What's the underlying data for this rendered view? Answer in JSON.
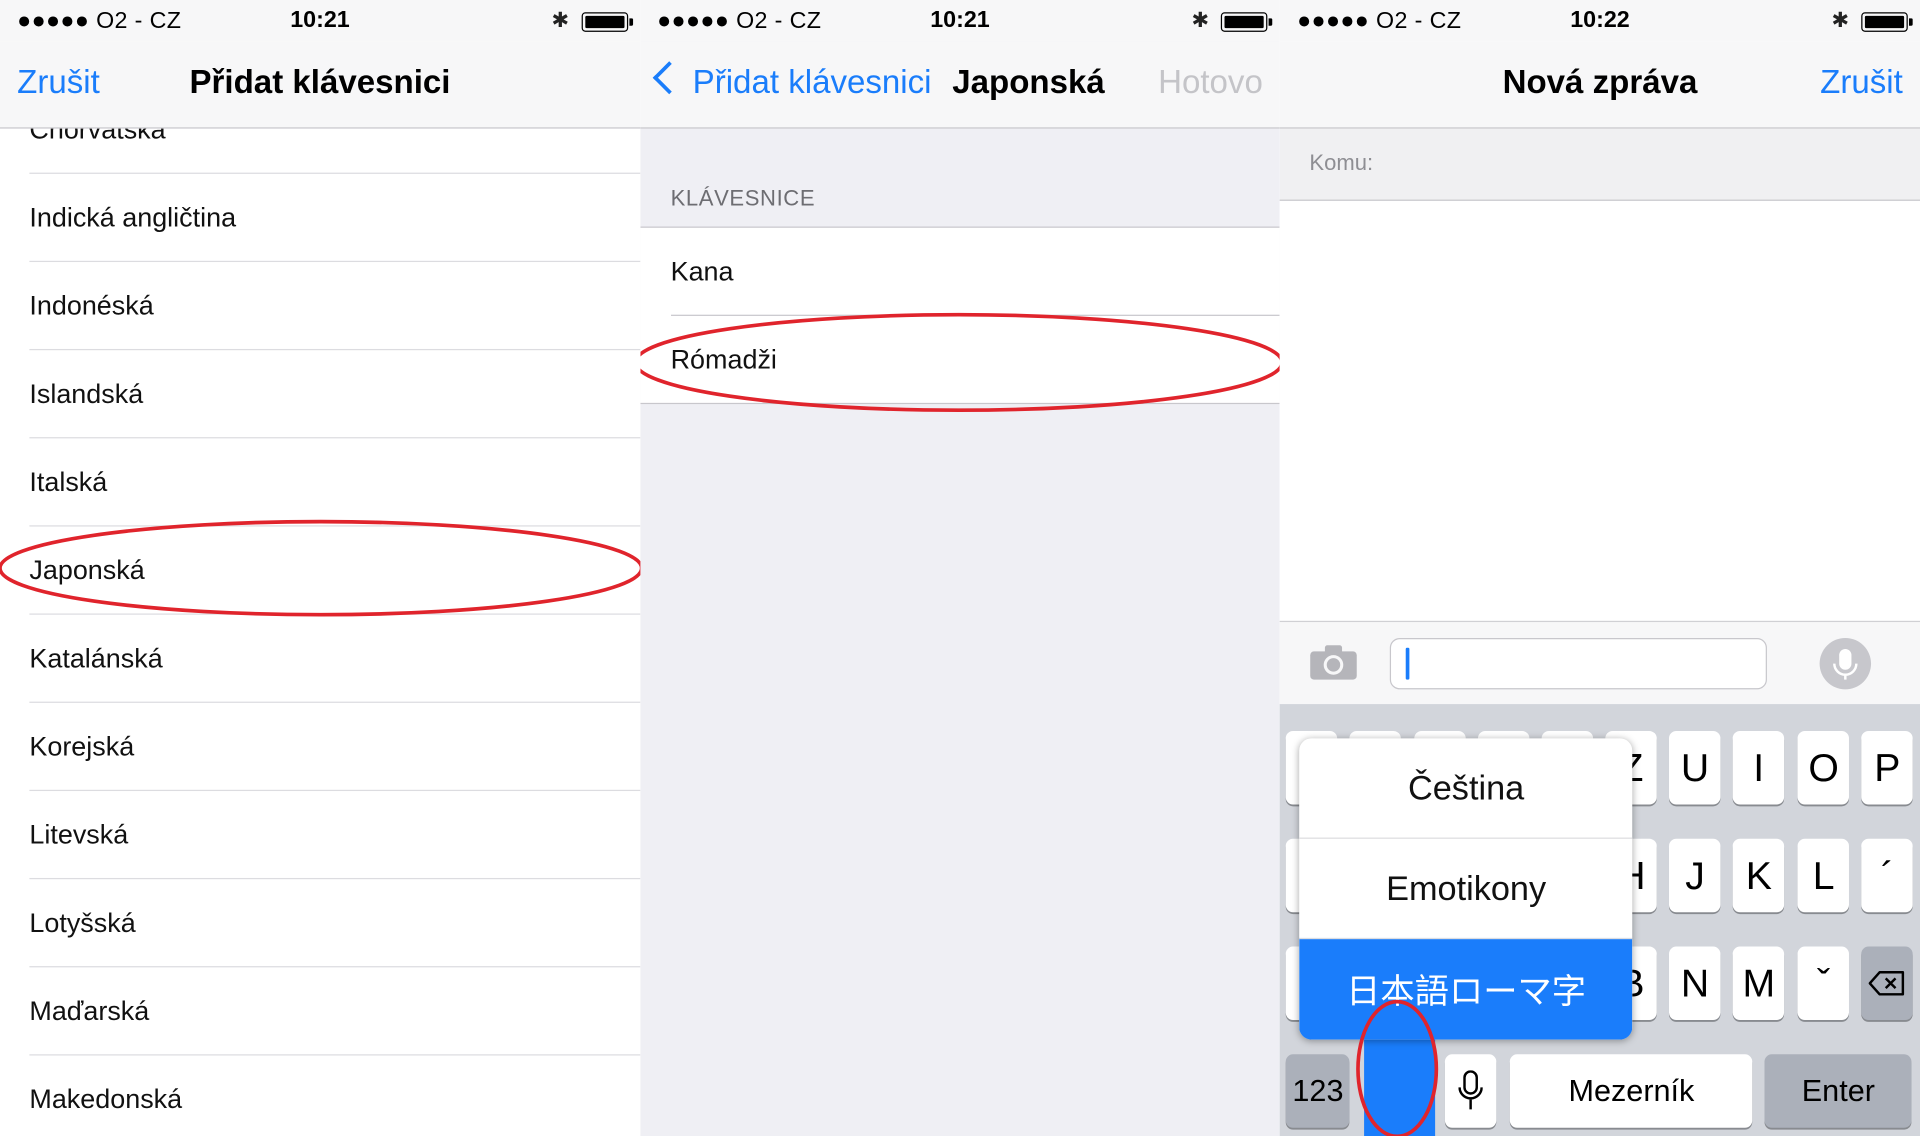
{
  "status": [
    {
      "carrier": "●●●●● O2 - CZ",
      "time": "10:21"
    },
    {
      "carrier": "●●●●● O2 - CZ",
      "time": "10:21"
    },
    {
      "carrier": "●●●●● O2 - CZ",
      "time": "10:22"
    }
  ],
  "panel1": {
    "nav": {
      "cancel": "Zrušit",
      "title": "Přidat klávesnici"
    },
    "items": [
      "Chorvatská",
      "Indická angličtina",
      "Indonéská",
      "Islandská",
      "Italská",
      "Japonská",
      "Katalánská",
      "Korejská",
      "Litevská",
      "Lotyšská",
      "Maďarská",
      "Makedonská"
    ],
    "highlighted": "Japonská"
  },
  "panel2": {
    "nav": {
      "back": "Přidat klávesnici",
      "title": "Japonská",
      "done": "Hotovo"
    },
    "section": "KLÁVESNICE",
    "items": [
      "Kana",
      "Rómadži"
    ],
    "highlighted": "Rómadži"
  },
  "panel3": {
    "nav": {
      "title": "Nová zpráva",
      "cancel": "Zrušit"
    },
    "to_label": "Komu:",
    "keys": {
      "row1_visible": [
        "Z",
        "U",
        "I",
        "O",
        "P"
      ],
      "row2_visible": [
        "H",
        "J",
        "K",
        "L",
        "´"
      ],
      "row3_visible": [
        "B",
        "N",
        "M",
        "ˇ"
      ],
      "numbers": "123",
      "space": "Mezerník",
      "enter": "Enter"
    },
    "popup": {
      "options": [
        "Čeština",
        "Emotikony",
        "日本語ローマ字"
      ],
      "selected": "日本語ローマ字"
    }
  },
  "colors": {
    "accent": "#1a7dfb",
    "annotation": "#e0242c",
    "keyboard_bg": "#d2d5db"
  }
}
